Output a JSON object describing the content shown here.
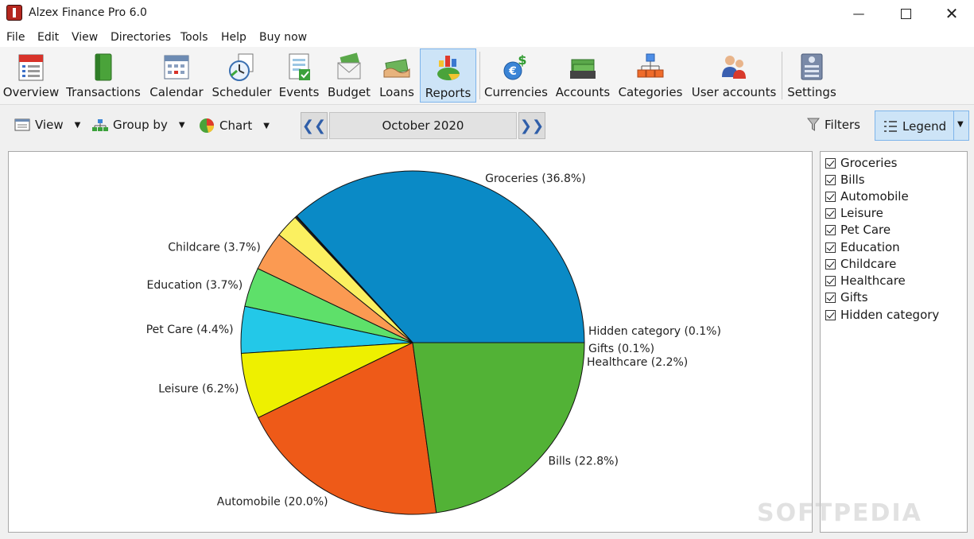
{
  "window": {
    "title": "Alzex Finance Pro 6.0"
  },
  "menu": [
    "File",
    "Edit",
    "View",
    "Directories",
    "Tools",
    "Help",
    "Buy now"
  ],
  "toolbar": [
    {
      "label": "Overview",
      "icon": "calendar-day-icon"
    },
    {
      "label": "Transactions",
      "icon": "book-icon"
    },
    {
      "label": "Calendar",
      "icon": "calendar-grid-icon"
    },
    {
      "label": "Scheduler",
      "icon": "scheduler-clock-icon"
    },
    {
      "label": "Events",
      "icon": "events-checklist-icon"
    },
    {
      "label": "Budget",
      "icon": "budget-envelope-icon"
    },
    {
      "label": "Loans",
      "icon": "loans-handshake-icon"
    },
    {
      "label": "Reports",
      "icon": "reports-pie-icon",
      "active": true
    },
    {
      "label": "Currencies",
      "icon": "currencies-coin-icon"
    },
    {
      "label": "Accounts",
      "icon": "accounts-cash-icon"
    },
    {
      "label": "Categories",
      "icon": "categories-tree-icon"
    },
    {
      "label": "User accounts",
      "icon": "users-icon"
    },
    {
      "label": "Settings",
      "icon": "settings-panel-icon"
    }
  ],
  "secondbar": {
    "view_label": "View",
    "group_label": "Group by",
    "chart_label": "Chart",
    "period": "October 2020",
    "filters_label": "Filters",
    "legend_label": "Legend"
  },
  "chart_data": {
    "type": "pie",
    "slices": [
      {
        "name": "Groceries",
        "label": "Groceries (36.8%)",
        "value": 36.8,
        "color": "#0a8ac6"
      },
      {
        "name": "Hidden category",
        "label": "Hidden category (0.1%)",
        "value": 0.1,
        "color": "#111111"
      },
      {
        "name": "Gifts",
        "label": "Gifts (0.1%)",
        "value": 0.1,
        "color": "#8a8a8a"
      },
      {
        "name": "Healthcare",
        "label": "Healthcare (2.2%)",
        "value": 2.2,
        "color": "#fbf060"
      },
      {
        "name": "Childcare",
        "label": "Childcare (3.7%)",
        "value": 3.7,
        "color": "#fb9a52"
      },
      {
        "name": "Education",
        "label": "Education (3.7%)",
        "value": 3.7,
        "color": "#5ee06a"
      },
      {
        "name": "Pet Care",
        "label": "Pet Care (4.4%)",
        "value": 4.4,
        "color": "#23c8e8"
      },
      {
        "name": "Leisure",
        "label": "Leisure (6.2%)",
        "value": 6.2,
        "color": "#eef000"
      },
      {
        "name": "Automobile",
        "label": "Automobile (20.0%)",
        "value": 20.0,
        "color": "#ee5a18"
      },
      {
        "name": "Bills",
        "label": "Bills (22.8%)",
        "value": 22.8,
        "color": "#52b236"
      }
    ]
  },
  "legend": {
    "items": [
      "Groceries",
      "Bills",
      "Automobile",
      "Leisure",
      "Pet Care",
      "Education",
      "Childcare",
      "Healthcare",
      "Gifts",
      "Hidden category"
    ]
  },
  "watermark": "SOFTPEDIA"
}
